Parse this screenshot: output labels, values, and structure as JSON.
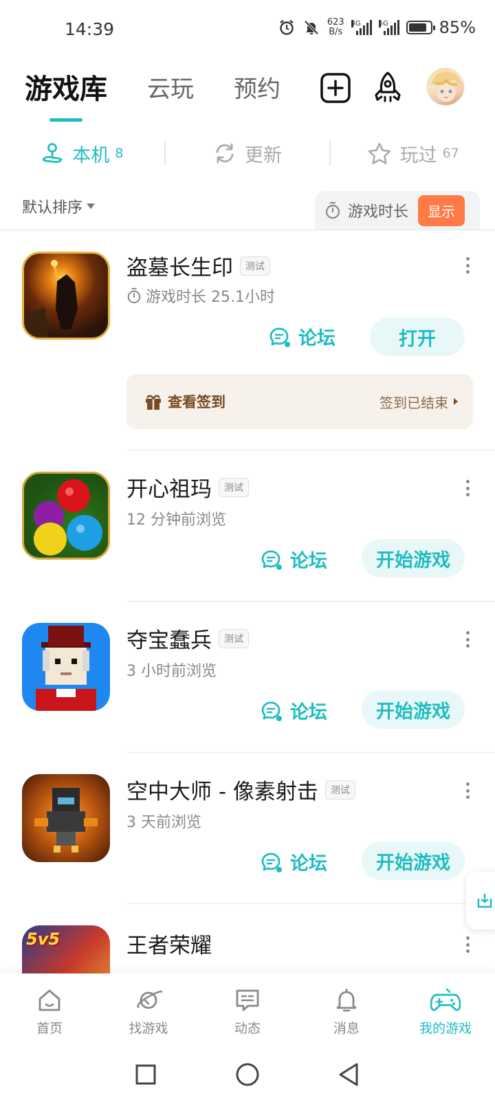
{
  "status_bar": {
    "time": "14:39",
    "net_speed_value": "623",
    "net_speed_unit": "B/s",
    "signal_1": "4G",
    "signal_2": "5G",
    "battery": "85%"
  },
  "header": {
    "tabs": [
      {
        "label": "游戏库",
        "active": true
      },
      {
        "label": "云玩",
        "active": false
      },
      {
        "label": "预约",
        "active": false
      }
    ]
  },
  "sub_tabs": [
    {
      "label": "本机",
      "count": "8",
      "active": true,
      "icon": "phone-stand-icon"
    },
    {
      "label": "更新",
      "count": "",
      "active": false,
      "icon": "refresh-icon"
    },
    {
      "label": "玩过",
      "count": "67",
      "active": false,
      "icon": "star-icon"
    }
  ],
  "sort": {
    "label": "默认排序",
    "playtime_label": "游戏时长",
    "show_button": "显示"
  },
  "games": [
    {
      "name": "盗墓长生印",
      "tag": "测试",
      "meta": "游戏时长 25.1小时",
      "forum": "论坛",
      "action": "打开",
      "signin": {
        "left": "查看签到",
        "right": "签到已结束"
      }
    },
    {
      "name": "开心祖玛",
      "tag": "测试",
      "meta": "12 分钟前浏览",
      "forum": "论坛",
      "action": "开始游戏"
    },
    {
      "name": "夺宝蠢兵",
      "tag": "测试",
      "meta": "3 小时前浏览",
      "forum": "论坛",
      "action": "开始游戏"
    },
    {
      "name": "空中大师 - 像素射击",
      "tag": "测试",
      "meta": "3 天前浏览",
      "forum": "论坛",
      "action": "开始游戏"
    },
    {
      "name": "王者荣耀",
      "icon_text": "5v5"
    }
  ],
  "bottom_nav": [
    {
      "label": "首页",
      "icon": "home-icon",
      "active": false
    },
    {
      "label": "找游戏",
      "icon": "planet-icon",
      "active": false
    },
    {
      "label": "动态",
      "icon": "chat-card-icon",
      "active": false
    },
    {
      "label": "消息",
      "icon": "bell-icon",
      "active": false
    },
    {
      "label": "我的游戏",
      "icon": "gamepad-icon",
      "active": true
    }
  ],
  "colors": {
    "accent": "#1fbdc2",
    "show_button": "#ff7a45",
    "signin_bg": "#f6f1ea"
  }
}
